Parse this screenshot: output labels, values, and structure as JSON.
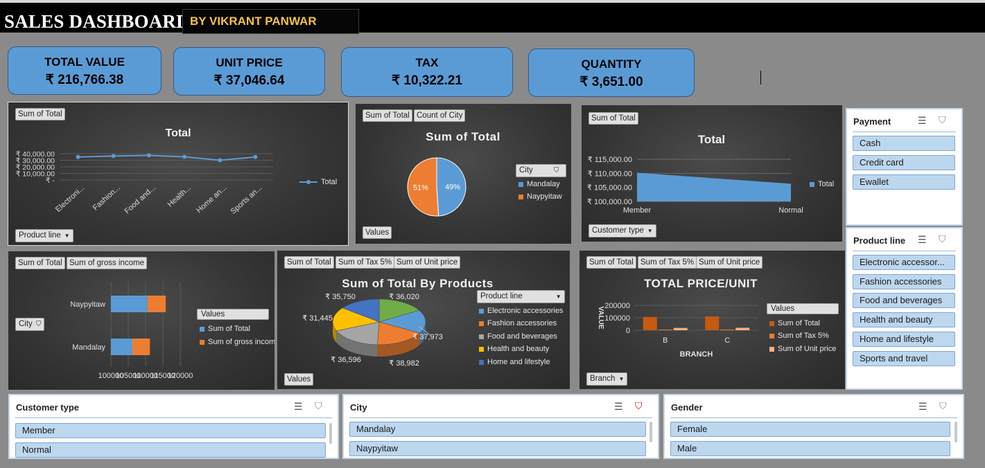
{
  "header": {
    "title": "SALES DASHBOARD",
    "byline": "BY VIKRANT PANWAR"
  },
  "kpis": [
    {
      "label": "TOTAL VALUE",
      "value": "₹ 216,766.38"
    },
    {
      "label": "UNIT PRICE",
      "value": "₹ 37,046.64"
    },
    {
      "label": "TAX",
      "value": "₹ 10,322.21"
    },
    {
      "label": "QUANTITY",
      "value": "₹  3,651.00"
    }
  ],
  "chart1": {
    "field_btn": "Sum of Total",
    "title": "Total",
    "filter_btn": "Product line",
    "legend": "Total"
  },
  "chart2": {
    "field_btn1": "Sum of Total",
    "field_btn2": "Count of City",
    "title": "Sum of Total",
    "legend_btn": "City",
    "values_btn": "Values"
  },
  "chart3": {
    "field_btn": "Sum of Total",
    "title": "Total",
    "filter_btn": "Customer type",
    "legend": "Total"
  },
  "chart4": {
    "field_btn1": "Sum of Total",
    "field_btn2": "Sum of gross income",
    "filter_btn": "City",
    "legend_title": "Values"
  },
  "chart5": {
    "field_btn1": "Sum of Total",
    "field_btn2": "Sum of Tax 5%",
    "field_btn3": "Sum of Unit price",
    "title": "Sum of Total By Products",
    "legend_btn": "Product line",
    "values_btn": "Values"
  },
  "chart6": {
    "field_btn1": "Sum of Total",
    "field_btn2": "Sum of Tax 5%",
    "field_btn3": "Sum of Unit price",
    "title": "TOTAL PRICE/UNIT",
    "legend_title": "Values",
    "filter_btn": "Branch"
  },
  "chart_data": [
    {
      "type": "line",
      "title": "Total",
      "categories": [
        "Electroni...",
        "Fashion...",
        "Food and...",
        "Health...",
        "Home an...",
        "Sports an..."
      ],
      "series": [
        {
          "name": "Total",
          "values": [
            35000,
            36500,
            37500,
            35200,
            30000,
            35000
          ]
        }
      ],
      "yticks": [
        "₹ 40,000.00",
        "₹ 30,000.00",
        "₹ 20,000.00",
        "₹ 10,000.00",
        "₹ -"
      ],
      "ylim": [
        0,
        40000
      ],
      "legend": "right",
      "color": "#5b9bd5"
    },
    {
      "type": "pie",
      "title": "Sum of Total",
      "categories": [
        "Mandalay",
        "Naypyitaw"
      ],
      "values": [
        49,
        51
      ],
      "labels": [
        "49%",
        "51%"
      ],
      "colors": [
        "#5b9bd5",
        "#ed7d31"
      ],
      "legend": "right"
    },
    {
      "type": "area",
      "title": "Total",
      "categories": [
        "Member",
        "Normal"
      ],
      "series": [
        {
          "name": "Total",
          "values": [
            110200,
            106300
          ]
        }
      ],
      "yticks": [
        "₹ 115,000.00",
        "₹ 110,000.00",
        "₹ 105,000.00",
        "₹ 100,000.00"
      ],
      "ylim": [
        100000,
        115000
      ],
      "legend": "right",
      "color": "#5b9bd5"
    },
    {
      "type": "bar",
      "categories": [
        "Mandalay",
        "Naypyitaw"
      ],
      "series": [
        {
          "name": "Sum of Total",
          "values": [
            106197,
            110569
          ]
        },
        {
          "name": "Sum of gross income",
          "values": [
            5057,
            5265
          ]
        }
      ],
      "xticks": [
        "100000",
        "105000",
        "110000",
        "115000",
        "120000"
      ],
      "xlim": [
        100000,
        120000
      ],
      "colors": [
        "#5b9bd5",
        "#ed7d31"
      ],
      "legend": "right"
    },
    {
      "type": "pie",
      "title": "Sum of Total By Products",
      "categories": [
        "Electronic accessories",
        "Fashion accessories",
        "Food and beverages",
        "Health and beauty",
        "Home and lifestyle",
        "Sports and travel"
      ],
      "values": [
        36020,
        37973,
        38982,
        36596,
        31445,
        35750
      ],
      "labels": [
        "₹ 36,020",
        "₹ 37,973",
        "₹ 38,982",
        "₹ 36,596",
        "₹ 31,445",
        "₹ 35,750"
      ],
      "legend_entries": [
        "Electronic accessories",
        "Fashion accessories",
        "Food and beverages",
        "Health and beauty",
        "Home and lifestyle"
      ],
      "colors": [
        "#5b9bd5",
        "#ed7d31",
        "#a5a5a5",
        "#ffc000",
        "#4472c4",
        "#70ad47"
      ],
      "legend": "right"
    },
    {
      "type": "bar",
      "title": "TOTAL PRICE/UNIT",
      "categories": [
        "B",
        "C"
      ],
      "series": [
        {
          "name": "Sum of Total",
          "values": [
            106198,
            110569
          ]
        },
        {
          "name": "Sum of Tax 5%",
          "values": [
            5057,
            5265
          ]
        },
        {
          "name": "Sum of Unit price",
          "values": [
            18479,
            19624
          ]
        }
      ],
      "yticks": [
        "200000",
        "100000",
        "0"
      ],
      "ylim": [
        0,
        200000
      ],
      "ylabel": "VALUE",
      "xlabel": "BRANCH",
      "colors": [
        "#c55a11",
        "#ed7d31",
        "#f4b183"
      ],
      "legend": "right"
    }
  ],
  "slicers": {
    "payment": {
      "title": "Payment",
      "items": [
        "Cash",
        "Credit card",
        "Ewallet"
      ]
    },
    "product_line": {
      "title": "Product line",
      "items": [
        "Electronic accessor...",
        "Fashion accessories",
        "Food and beverages",
        "Health and beauty",
        "Home and lifestyle",
        "Sports and travel"
      ]
    },
    "customer_type": {
      "title": "Customer type",
      "items": [
        "Member",
        "Normal"
      ]
    },
    "city": {
      "title": "City",
      "items": [
        "Mandalay",
        "Naypyitaw"
      ]
    },
    "gender": {
      "title": "Gender",
      "items": [
        "Female",
        "Male"
      ]
    }
  },
  "icons": {
    "multiselect": "multi-select-icon",
    "clear_filter": "clear-filter-icon",
    "funnel": "funnel-icon"
  }
}
